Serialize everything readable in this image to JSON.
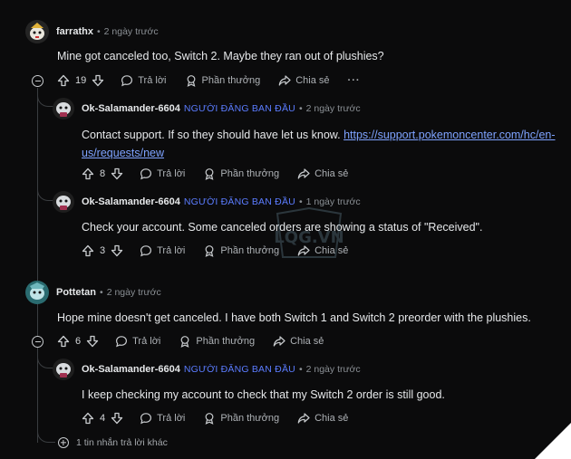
{
  "labels": {
    "reply": "Trả lời",
    "award": "Phần thưởng",
    "share": "Chia sẻ",
    "more": "···",
    "op_badge": "NGƯỜI ĐĂNG BAN ĐẦU"
  },
  "comments": [
    {
      "user": "farrathx",
      "time": "2 ngày trước",
      "text": "Mine got canceled too, Switch 2. Maybe they ran out of plushies?",
      "votes": "19",
      "avatar_color": "#e3e0d6"
    },
    {
      "user": "Ok-Salamander-6604",
      "time": "2 ngày trước",
      "text_prefix": "Contact support. If so they should have let us know. ",
      "link": "https://support.pokemoncenter.com/hc/en-us/requests/new",
      "link_line1": "https://support.pokemoncenter.com/hc/en-",
      "link_line2": "us/requests/new",
      "votes": "8"
    },
    {
      "user": "Ok-Salamander-6604",
      "time": "1 ngày trước",
      "text": "Check your account. Some canceled orders are showing a status of \"Received\".",
      "votes": "3"
    },
    {
      "user": "Pottetan",
      "time": "2 ngày trước",
      "text": "Hope mine doesn't get canceled. I have both Switch 1 and Switch 2 preorder with the plushies.",
      "votes": "6",
      "avatar_color": "#3f8f93"
    },
    {
      "user": "Ok-Salamander-6604",
      "time": "2 ngày trước",
      "text": "I keep checking my account to check that my Switch 2 order is still good.",
      "votes": "4"
    }
  ],
  "more_replies": "1 tin nhắn trả lời khác",
  "watermark_text": "LQG.VN"
}
